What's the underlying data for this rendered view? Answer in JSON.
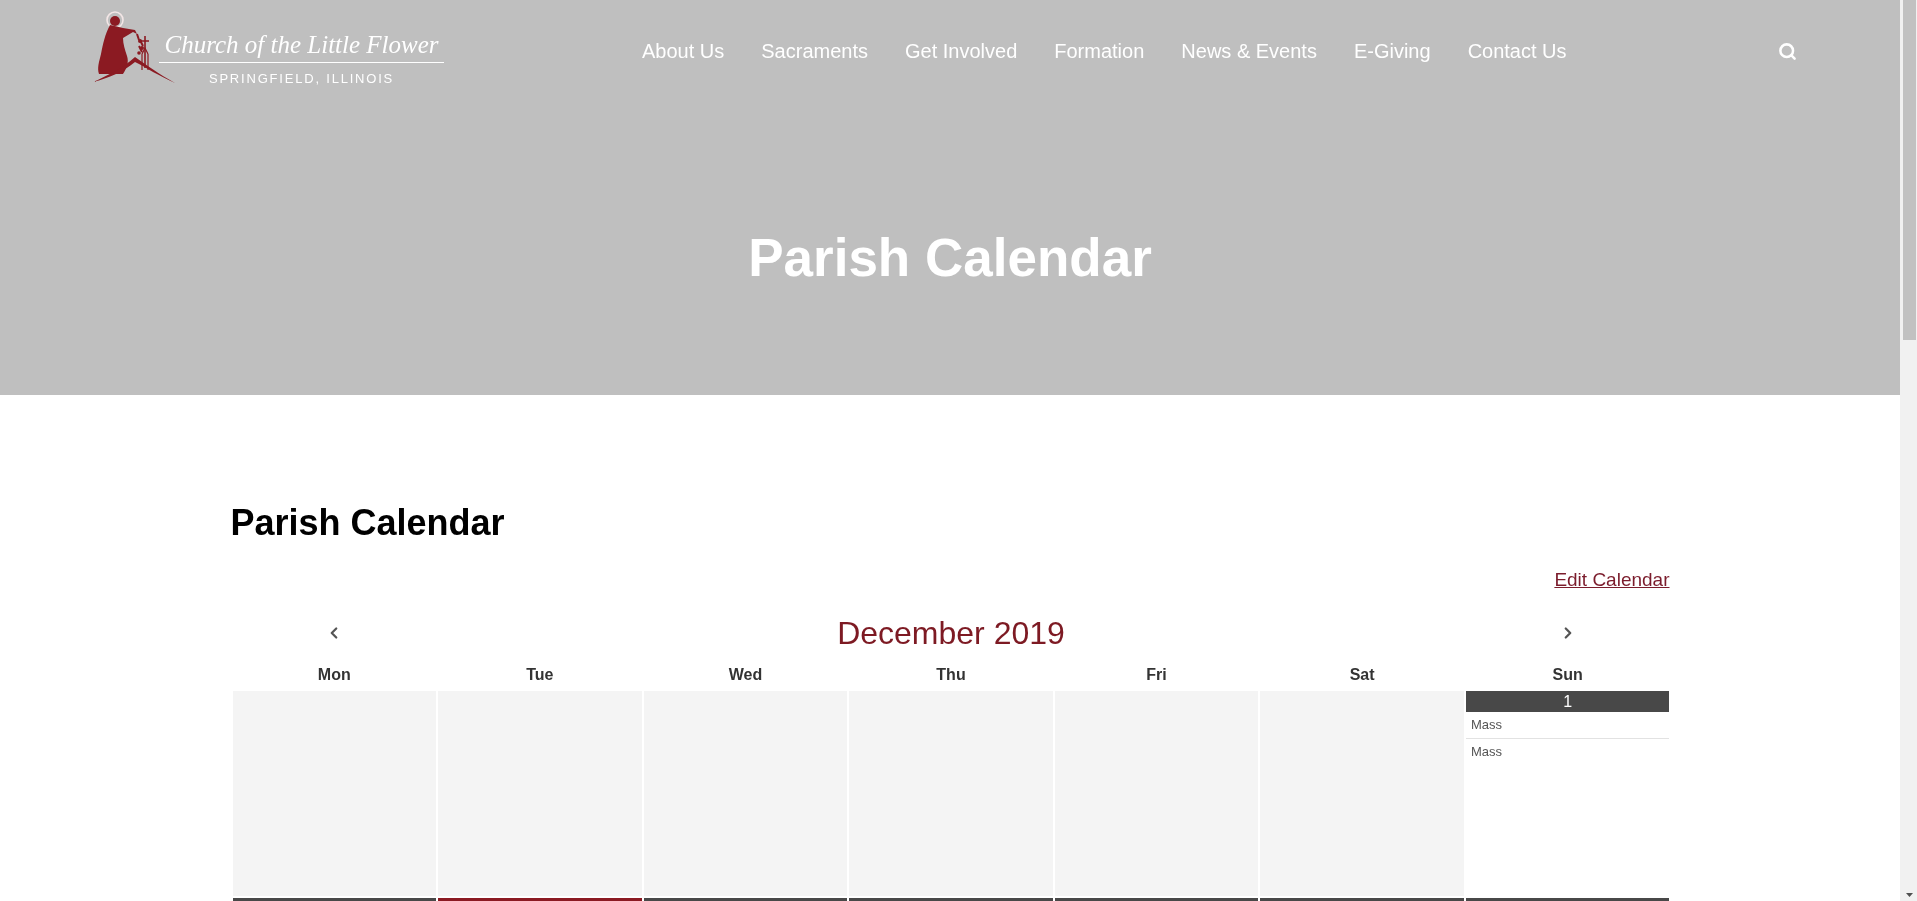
{
  "logo": {
    "name": "Church of the Little Flower",
    "place": "SPRINGFIELD, ILLINOIS"
  },
  "nav": {
    "items": [
      "About Us",
      "Sacraments",
      "Get Involved",
      "Formation",
      "News & Events",
      "E-Giving",
      "Contact Us"
    ]
  },
  "hero": {
    "title": "Parish Calendar"
  },
  "content": {
    "title": "Parish Calendar",
    "edit_link": "Edit Calendar"
  },
  "calendar": {
    "month": "December 2019",
    "weekdays": [
      "Mon",
      "Tue",
      "Wed",
      "Thu",
      "Fri",
      "Sat",
      "Sun"
    ],
    "weeks": [
      {
        "days": [
          {
            "in_month": false
          },
          {
            "in_month": false
          },
          {
            "in_month": false
          },
          {
            "in_month": false
          },
          {
            "in_month": false
          },
          {
            "in_month": false
          },
          {
            "in_month": true,
            "today": false,
            "date": "1",
            "events": [
              "Mass",
              "Mass"
            ]
          }
        ]
      },
      {
        "days": [
          {
            "in_month": true,
            "today": false
          },
          {
            "in_month": true,
            "today": true
          },
          {
            "in_month": true,
            "today": false
          },
          {
            "in_month": true,
            "today": false
          },
          {
            "in_month": true,
            "today": false
          },
          {
            "in_month": true,
            "today": false
          },
          {
            "in_month": true,
            "today": false
          }
        ]
      }
    ]
  }
}
